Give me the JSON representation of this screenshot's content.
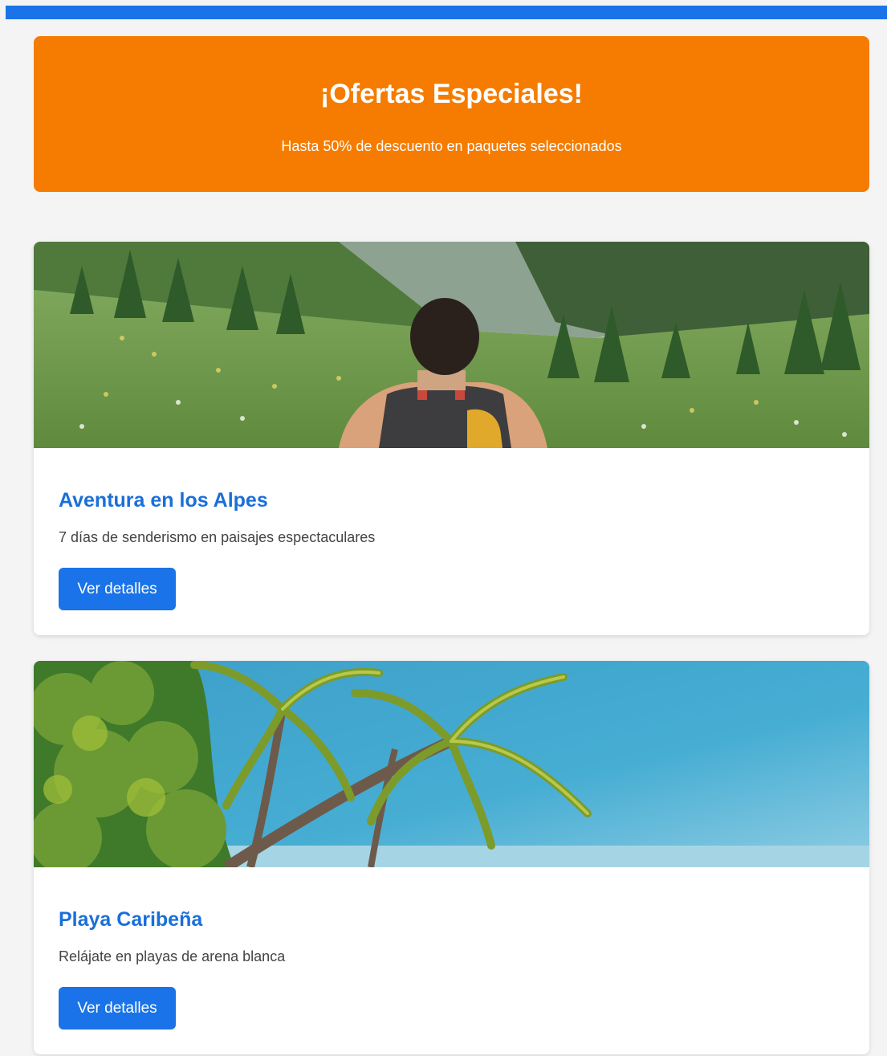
{
  "colors": {
    "accent": "#1a73e8",
    "banner": "#f57c00",
    "title": "#1a6fd8",
    "background": "#f4f4f4"
  },
  "banner": {
    "title": "¡Ofertas Especiales!",
    "subtitle": "Hasta 50% de descuento en paquetes seleccionados"
  },
  "cards": [
    {
      "image": "mountain-hiker-photo",
      "title": "Aventura en los Alpes",
      "description": "7 días de senderismo en paisajes espectaculares",
      "button_label": "Ver detalles"
    },
    {
      "image": "caribbean-palm-trees-photo",
      "title": "Playa Caribeña",
      "description": "Relájate en playas de arena blanca",
      "button_label": "Ver detalles"
    }
  ]
}
